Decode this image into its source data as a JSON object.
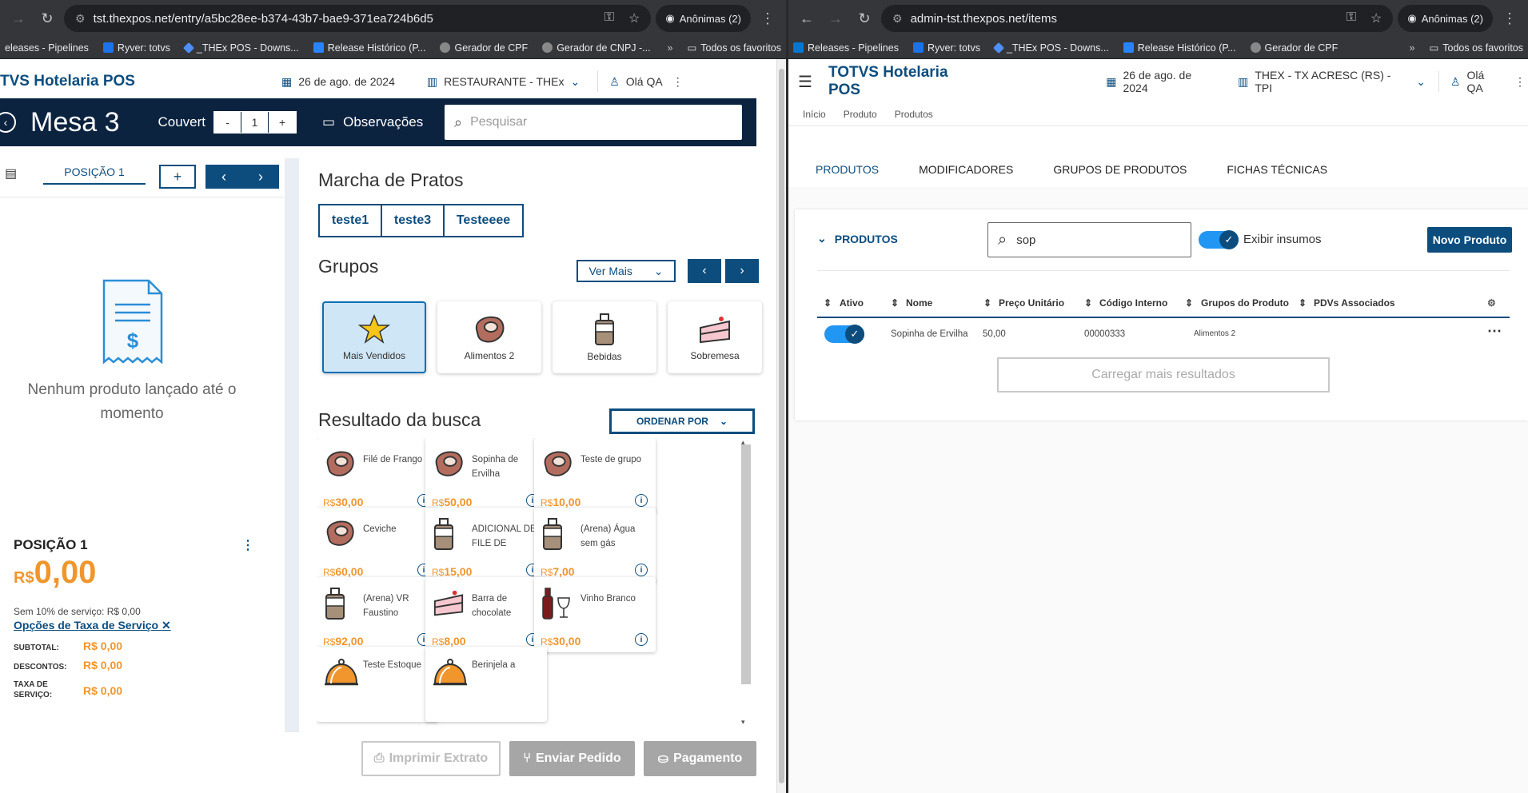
{
  "left": {
    "browser": {
      "url": "tst.thexpos.net/entry/a5bc28ee-b374-43b7-bae9-371ea724b6d5",
      "incognito": "Anônimas (2)",
      "bookmarks": [
        "eleases - Pipelines",
        "Ryver: totvs",
        "_THEx POS - Downs...",
        "Release Histórico (P...",
        "Gerador de CPF",
        "Gerador de CNPJ -..."
      ],
      "all_bookmarks": "Todos os favoritos"
    },
    "header": {
      "title": "TVS Hotelaria POS",
      "date": "26 de ago. de 2024",
      "store": "RESTAURANTE - THEx",
      "user": "Olá QA"
    },
    "mesa": {
      "title": "Mesa 3",
      "couvert_label": "Couvert",
      "couvert_minus": "-",
      "couvert_value": "1",
      "couvert_plus": "+",
      "obs": "Observações",
      "search_placeholder": "Pesquisar"
    },
    "position_panel": {
      "tab": "POSIÇÃO 1",
      "empty": "Nenhum produto lançado até o momento",
      "pos_title": "POSIÇÃO 1",
      "currency": "R$",
      "total": "0,00",
      "service_note": "Sem 10% de serviço: R$ 0,00",
      "service_options": "Opções de Taxa de Serviço",
      "subtotal_label": "SUBTOTAL:",
      "subtotal": "R$ 0,00",
      "discounts_label": "DESCONTOS:",
      "discounts": "R$ 0,00",
      "service_label_1": "TAXA DE",
      "service_label_2": "SERVIÇO:",
      "service": "R$ 0,00"
    },
    "marcha": {
      "title": "Marcha de Pratos",
      "items": [
        "teste1",
        "teste3",
        "Testeeee"
      ]
    },
    "grupos": {
      "title": "Grupos",
      "ver_mais": "Ver Mais",
      "items": [
        "Mais Vendidos",
        "Alimentos 2",
        "Bebidas",
        "Sobremesa"
      ]
    },
    "results": {
      "title": "Resultado da busca",
      "order_by": "ORDENAR POR",
      "items": [
        {
          "name": "Filé de Frango",
          "price": "30,00",
          "icon": "meat-icon"
        },
        {
          "name": "Sopinha de Ervilha",
          "price": "50,00",
          "icon": "meat-icon"
        },
        {
          "name": "Teste de grupo",
          "price": "10,00",
          "icon": "meat-icon"
        },
        {
          "name": "Ceviche",
          "price": "60,00",
          "icon": "meat-icon"
        },
        {
          "name": "ADICIONAL DE FILE DE",
          "price": "15,00",
          "icon": "bottle-icon"
        },
        {
          "name": "(Arena) Água sem gás",
          "price": "7,00",
          "icon": "bottle-icon"
        },
        {
          "name": "(Arena) VR Faustino",
          "price": "92,00",
          "icon": "bottle-icon"
        },
        {
          "name": "Barra de chocolate",
          "price": "8,00",
          "icon": "cake-icon"
        },
        {
          "name": "Vinho Branco",
          "price": "30,00",
          "icon": "wine-icon"
        },
        {
          "name": "Teste Estoque",
          "price": "",
          "icon": "cloche-icon"
        },
        {
          "name": "Berinjela a",
          "price": "",
          "icon": "cloche-icon"
        }
      ]
    },
    "footer": {
      "print": "Imprimir Extrato",
      "send": "Enviar Pedido",
      "pay": "Pagamento"
    }
  },
  "right": {
    "browser": {
      "url": "admin-tst.thexpos.net/items",
      "incognito": "Anônimas (2)",
      "bookmarks": [
        "Releases - Pipelines",
        "Ryver: totvs",
        "_THEx POS - Downs...",
        "Release Histórico (P...",
        "Gerador de CPF"
      ],
      "all_bookmarks": "Todos os favoritos"
    },
    "header": {
      "title": "TOTVS Hotelaria POS",
      "date": "26 de ago. de 2024",
      "store": "THEX - TX ACRESC (RS) - TPI",
      "user": "Olá QA"
    },
    "breadcrumb": [
      "Início",
      "Produto",
      "Produtos"
    ],
    "tabs": [
      "PRODUTOS",
      "MODIFICADORES",
      "GRUPOS DE PRODUTOS",
      "FICHAS TÉCNICAS"
    ],
    "section": "PRODUTOS",
    "search_value": "sop",
    "show_inputs_label": "Exibir insumos",
    "new_product": "Novo Produto",
    "table": {
      "headers": [
        "Ativo",
        "Nome",
        "Preço Unitário",
        "Código Interno",
        "Grupos do Produto",
        "PDVs Associados"
      ],
      "rows": [
        {
          "name": "Sopinha de Ervilha",
          "price": "50,00",
          "code": "00000333",
          "group": "Alimentos 2",
          "pdvs": ""
        }
      ]
    },
    "load_more": "Carregar mais resultados"
  },
  "colors": {
    "primary": "#0c4d7e",
    "navy": "#0c2340",
    "accent": "#f0962d",
    "toggle": "#2196f3"
  }
}
